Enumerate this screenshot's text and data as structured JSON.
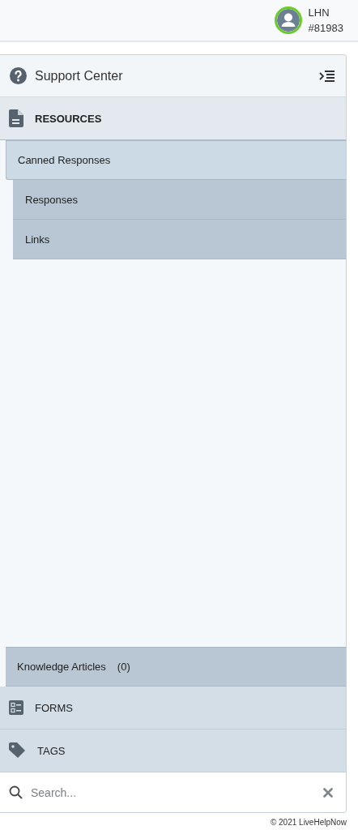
{
  "user": {
    "name": "LHN",
    "id": "#81983",
    "online": true
  },
  "panel": {
    "title": "Support Center",
    "sections": [
      {
        "kind": "resources",
        "label": "RESOURCES",
        "expanded": true,
        "items": [
          {
            "label": "Canned Responses",
            "expanded": true,
            "children": [
              {
                "label": "Responses"
              },
              {
                "label": "Links"
              }
            ]
          },
          {
            "label": "Knowledge Articles",
            "count": "(0)",
            "expanded": false
          }
        ]
      },
      {
        "kind": "forms",
        "label": "FORMS",
        "expanded": false
      },
      {
        "kind": "tags",
        "label": "TAGS",
        "expanded": false
      }
    ],
    "search": {
      "placeholder": "Search..."
    }
  },
  "footer": "© 2021 LiveHelpNow"
}
